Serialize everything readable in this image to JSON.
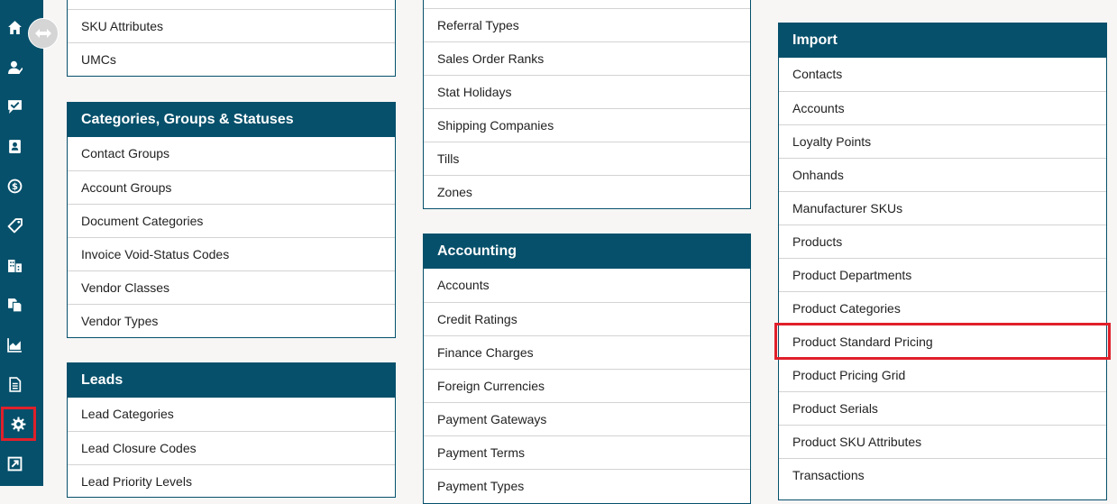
{
  "sidebar": {
    "items": [
      {
        "id": "home",
        "icon": "home-icon"
      },
      {
        "id": "contacts",
        "icon": "user-icon"
      },
      {
        "id": "tasks",
        "icon": "chat-check-icon"
      },
      {
        "id": "address-book",
        "icon": "address-book-icon"
      },
      {
        "id": "finance",
        "icon": "dollar-icon"
      },
      {
        "id": "products",
        "icon": "tag-icon"
      },
      {
        "id": "companies",
        "icon": "building-icon"
      },
      {
        "id": "documents",
        "icon": "copy-icon"
      },
      {
        "id": "reports",
        "icon": "chart-icon"
      },
      {
        "id": "files",
        "icon": "file-icon"
      },
      {
        "id": "settings",
        "icon": "gear-icon"
      },
      {
        "id": "external",
        "icon": "external-link-icon"
      }
    ],
    "toggle_icon": "expand-arrows-icon"
  },
  "panels": {
    "products_top": {
      "items": [
        "SKU Attributes",
        "UMCs"
      ]
    },
    "categories": {
      "title": "Categories, Groups & Statuses",
      "items": [
        "Contact Groups",
        "Account Groups",
        "Document Categories",
        "Invoice Void-Status Codes",
        "Vendor Classes",
        "Vendor Types"
      ]
    },
    "leads": {
      "title": "Leads",
      "items": [
        "Lead Categories",
        "Lead Closure Codes",
        "Lead Priority Levels"
      ]
    },
    "misc_top": {
      "items": [
        "Referral Types",
        "Sales Order Ranks",
        "Stat Holidays",
        "Shipping Companies",
        "Tills",
        "Zones"
      ]
    },
    "accounting": {
      "title": "Accounting",
      "items": [
        "Accounts",
        "Credit Ratings",
        "Finance Charges",
        "Foreign Currencies",
        "Payment Gateways",
        "Payment Terms",
        "Payment Types"
      ]
    },
    "import": {
      "title": "Import",
      "items": [
        "Contacts",
        "Accounts",
        "Loyalty Points",
        "Onhands",
        "Manufacturer SKUs",
        "Products",
        "Product Departments",
        "Product Categories",
        "Product Standard Pricing",
        "Product Pricing Grid",
        "Product Serials",
        "Product SKU Attributes",
        "Transactions"
      ]
    }
  },
  "colors": {
    "primary": "#06506b",
    "highlight": "#e0202a"
  }
}
